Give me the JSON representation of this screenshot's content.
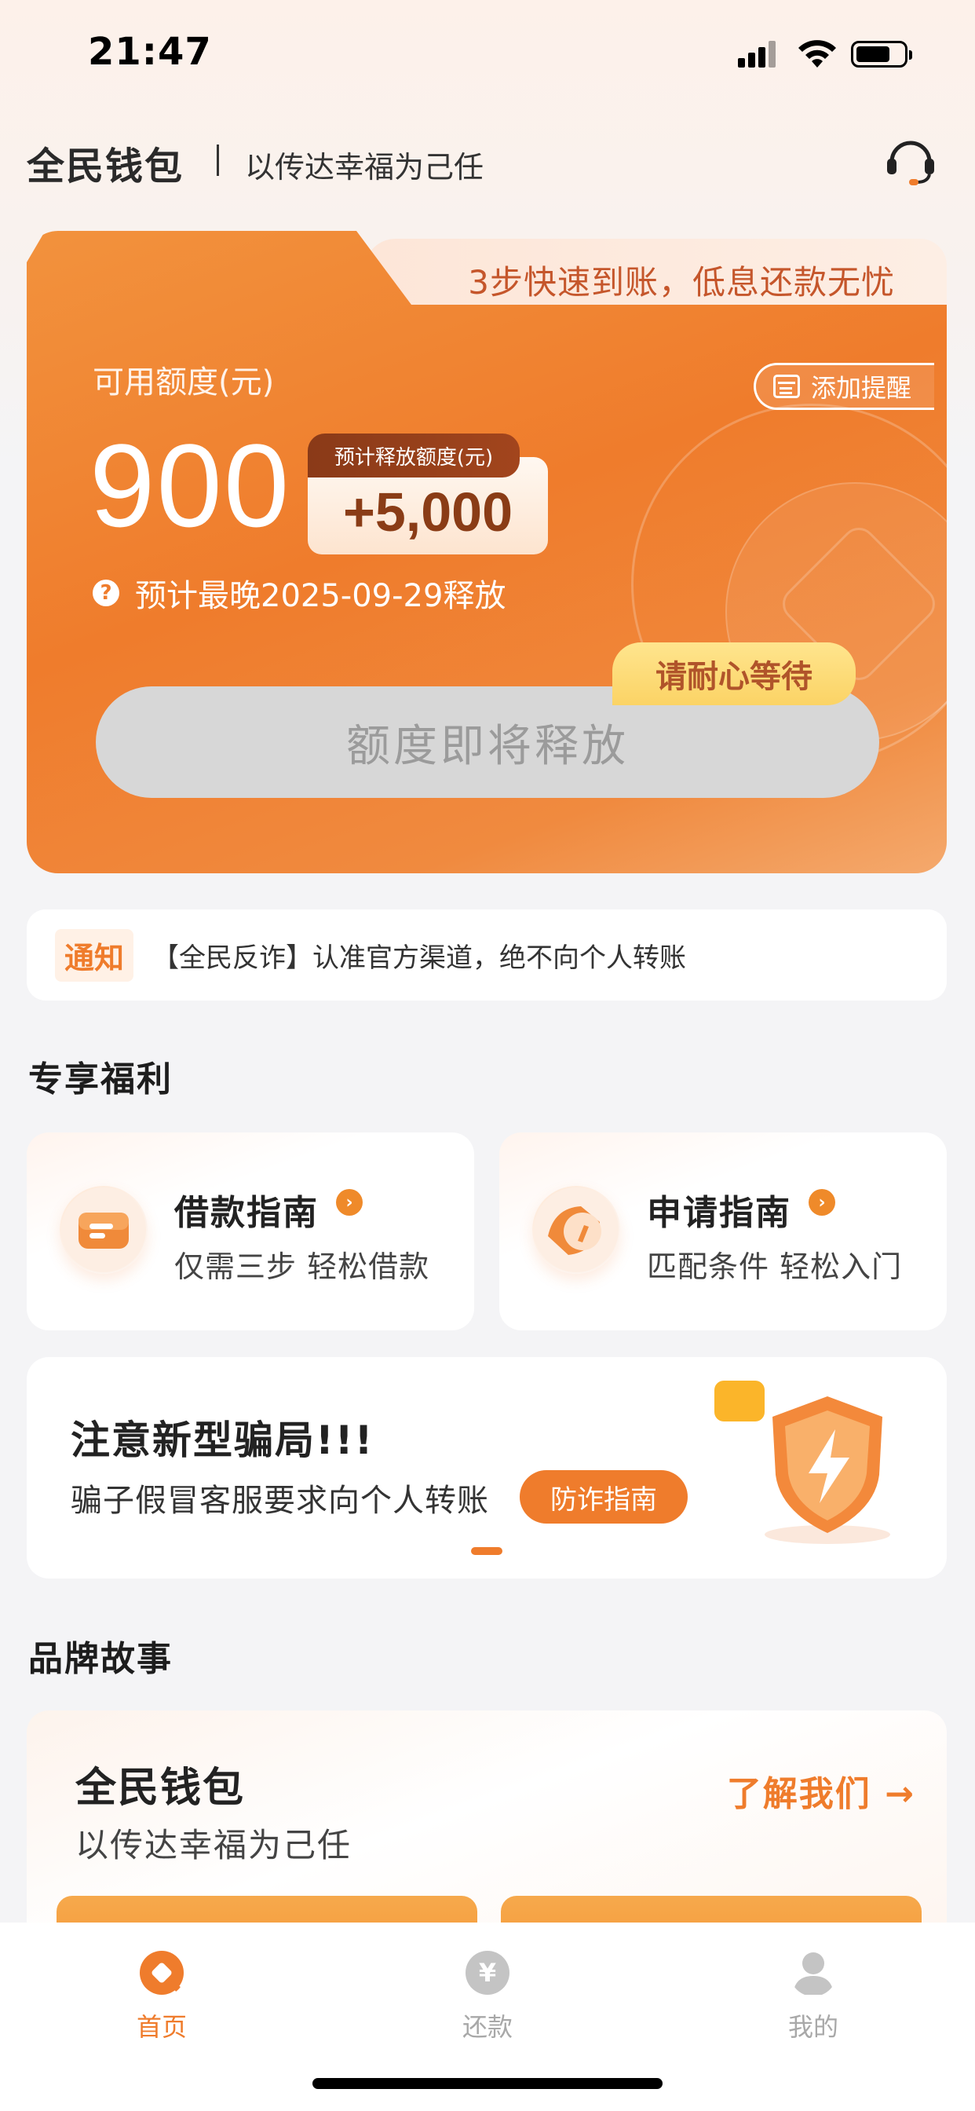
{
  "status_bar": {
    "time": "21:47"
  },
  "header": {
    "brand": "全民钱包",
    "slogan": "以传达幸福为己任"
  },
  "credit_card": {
    "tab_text": "3步快速到账，低息还款无忧",
    "available_label": "可用额度(元)",
    "add_reminder": "添加提醒",
    "amount": "900",
    "release_tag": "预计释放额度(元)",
    "release_value": "+5,000",
    "release_date_text": "预计最晚2025-09-29释放",
    "wait_badge": "请耐心等待",
    "main_button": "额度即将释放"
  },
  "notice": {
    "tag": "通知",
    "text": "【全民反诈】认准官方渠道，绝不向个人转账"
  },
  "benefits": {
    "title": "专享福利",
    "items": [
      {
        "title": "借款指南",
        "subtitle": "仅需三步 轻松借款"
      },
      {
        "title": "申请指南",
        "subtitle": "匹配条件 轻松入门"
      }
    ]
  },
  "scam_banner": {
    "title": "注意新型骗局!!!",
    "subtitle": "骗子假冒客服要求向个人转账",
    "button": "防诈指南"
  },
  "brand_story": {
    "title": "品牌故事",
    "card_title": "全民钱包",
    "card_subtitle": "以传达幸福为己任",
    "link": "了解我们 →"
  },
  "tabbar": {
    "items": [
      {
        "label": "首页",
        "active": true
      },
      {
        "label": "还款",
        "active": false
      },
      {
        "label": "我的",
        "active": false
      }
    ]
  },
  "colors": {
    "accent": "#ef7c2c",
    "inactive": "#a8a8a8"
  }
}
